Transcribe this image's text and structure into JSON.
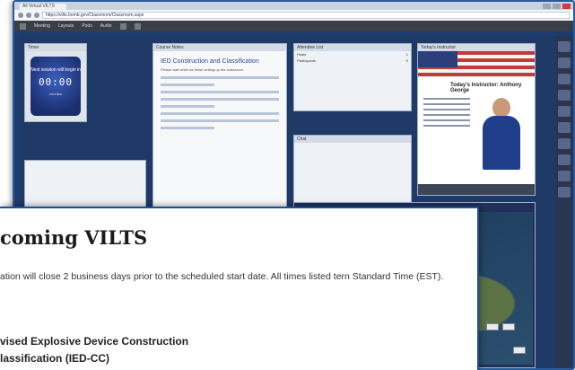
{
  "browser": {
    "tab_title": "All Virtual VILTS",
    "url": "https://vilts.bomb.gov/Classroom/Classroom.aspx",
    "app_menu": [
      "Meeting",
      "Layouts",
      "Pods",
      "Audio"
    ]
  },
  "timer_pod": {
    "header": "Timer",
    "label": "Next session will begin in",
    "time": "00:00",
    "sub": "minutes"
  },
  "notes_pod": {
    "header": "Course Notes",
    "title": "IED Construction and Classification",
    "subtitle": "Please wait while we finish setting up the classroom"
  },
  "chat_pod": {
    "header": "Attendee List",
    "rows": [
      {
        "name": "Hosts",
        "count": "1"
      },
      {
        "name": "Participants",
        "count": "0"
      }
    ]
  },
  "qa_pod": {
    "header": "Chat"
  },
  "media_pod": {
    "header": "Today's Instructor",
    "instructor_heading": "Today's Instructor: Anthony George"
  },
  "overlay": {
    "heading_visible": "coming VILTS",
    "body_visible": "ation will close 2 business days prior to the scheduled start date. All times listed tern Standard Time (EST).",
    "course_line1": "vised Explosive Device Construction",
    "course_line2": "lassification (IED-CC)"
  },
  "colors": {
    "overlay_border": "#1e4f9c",
    "workspace_bg": "#1f3a66",
    "heading_text": "#1b1b1b"
  }
}
